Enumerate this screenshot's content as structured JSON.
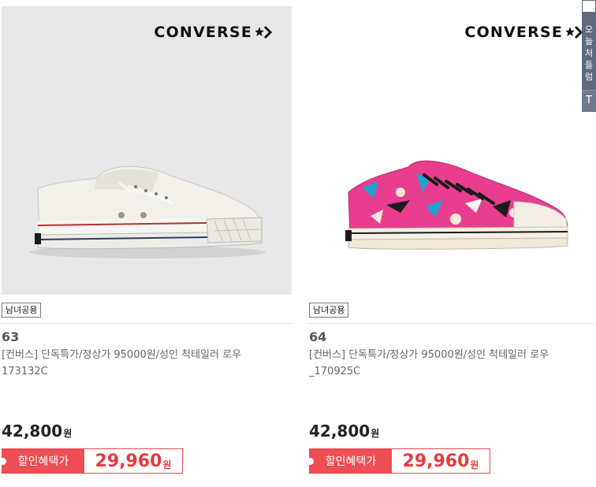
{
  "products": [
    {
      "brand": "CONVERSE",
      "gender_badge": "남녀공용",
      "number": "63",
      "title": "[컨버스] 단독특가/정상가 95000원/성인 척테일러 로우 173132C",
      "price": "42,800",
      "price_unit": "원",
      "sale_label": "할인혜택가",
      "sale_price": "29,960",
      "sale_unit": "원",
      "colors": {
        "image_bg": "#e7e7e7",
        "shoe": "#f1efe9"
      }
    },
    {
      "brand": "CONVERSE",
      "gender_badge": "남녀공용",
      "number": "64",
      "title": "[컨버스] 단독특가/정상가 95000원/성인 척테일러 로우_170925C",
      "price": "42,800",
      "price_unit": "원",
      "sale_label": "할인혜택가",
      "sale_price": "29,960",
      "sale_unit": "원",
      "colors": {
        "image_bg": "#ffffff",
        "shoe": "#e93d8f"
      }
    }
  ],
  "side_panel": {
    "text": "오늘\n처\n들\n럼",
    "bar_symbol": "T"
  },
  "theme": {
    "sale_accent": "#ee4d53",
    "sale_price_color": "#e63b40"
  }
}
